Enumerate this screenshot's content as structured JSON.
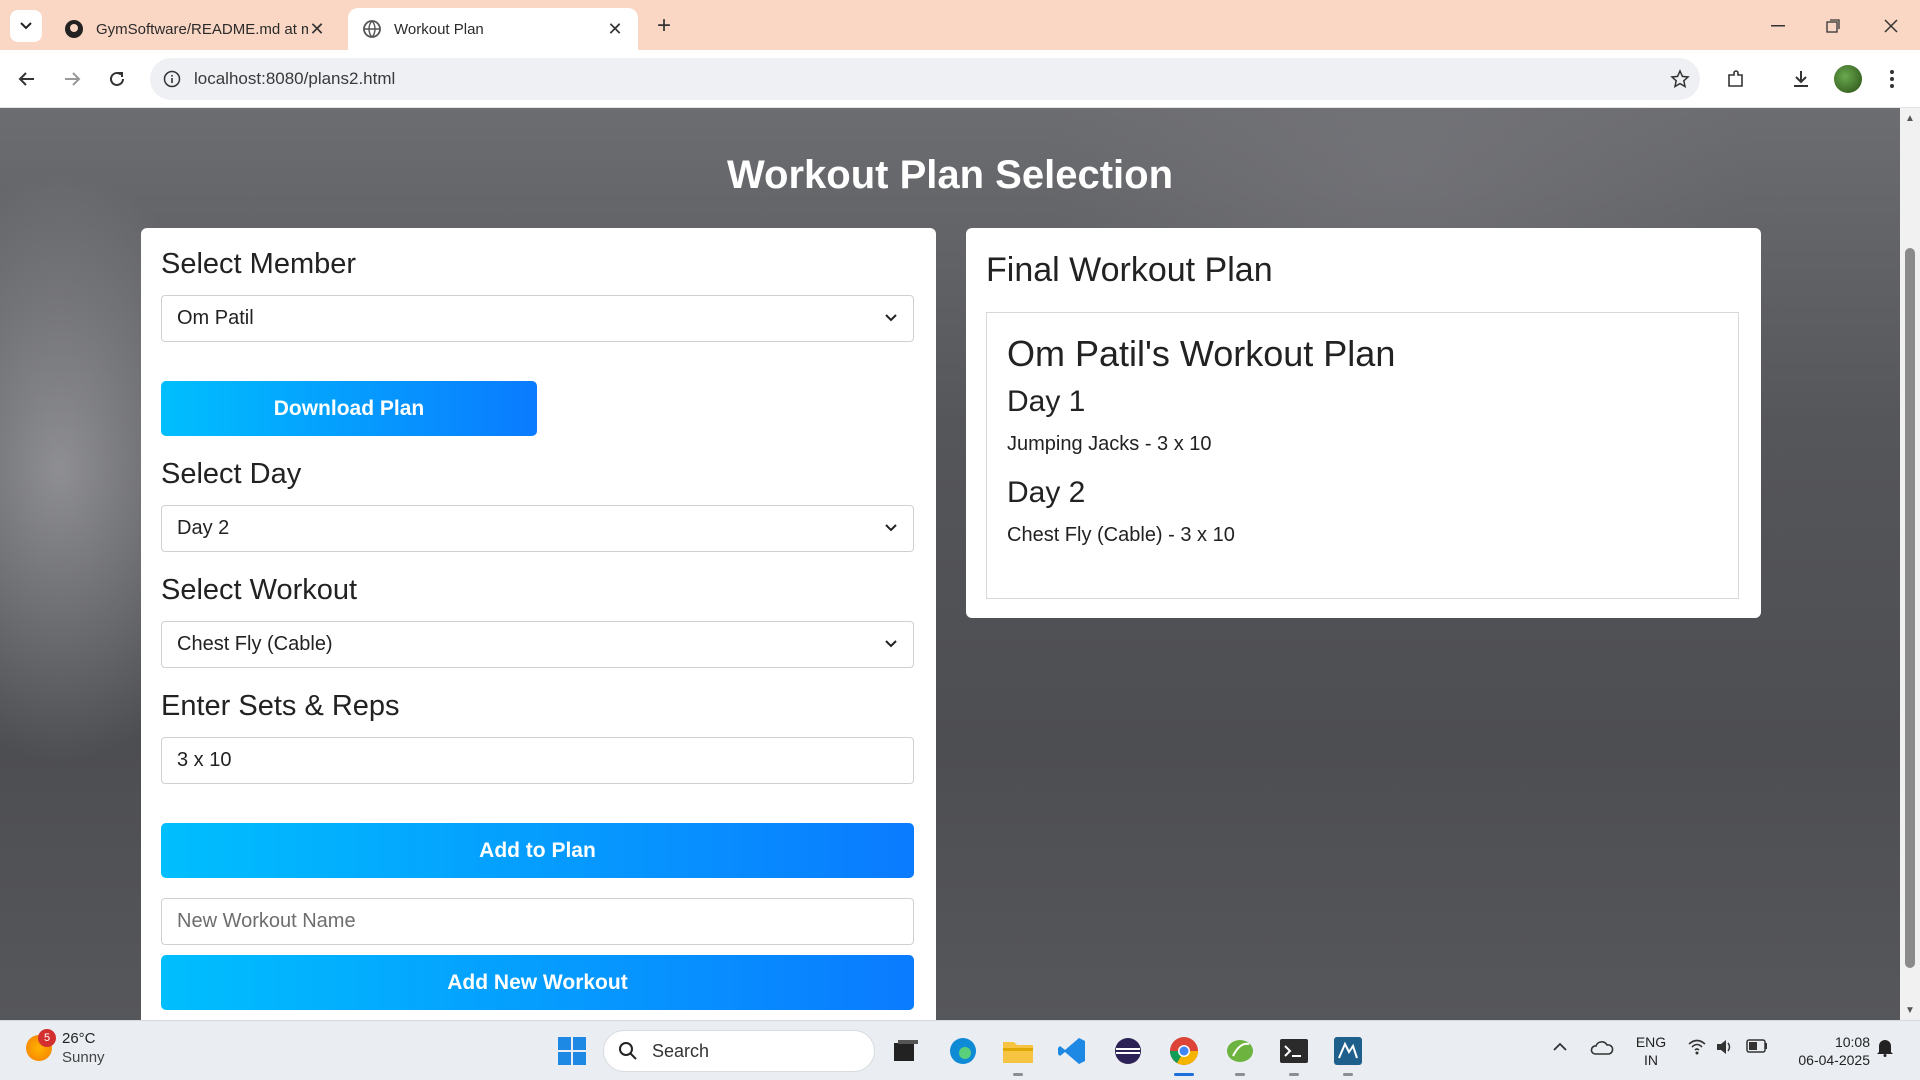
{
  "browser": {
    "tabs": [
      {
        "title": "GymSoftware/README.md at m",
        "icon": "github-icon",
        "active": false
      },
      {
        "title": "Workout Plan",
        "icon": "globe-icon",
        "active": true
      }
    ],
    "url": "localhost:8080/plans2.html"
  },
  "page": {
    "title": "Workout Plan Selection",
    "left": {
      "member_label": "Select Member",
      "member_value": "Om Patil",
      "download_button": "Download Plan",
      "day_label": "Select Day",
      "day_value": "Day 2",
      "workout_label": "Select Workout",
      "workout_value": "Chest Fly (Cable)",
      "sets_label": "Enter Sets & Reps",
      "sets_value": "3 x 10",
      "add_button": "Add to Plan",
      "new_workout_placeholder": "New Workout Name",
      "add_new_button": "Add New Workout"
    },
    "right": {
      "title": "Final Workout Plan",
      "plan_title": "Om Patil's Workout Plan",
      "days": [
        {
          "label": "Day 1",
          "item": "Jumping Jacks - 3 x 10"
        },
        {
          "label": "Day 2",
          "item": "Chest Fly (Cable) - 3 x 10"
        }
      ]
    }
  },
  "taskbar": {
    "weather_badge": "5",
    "temp": "26°C",
    "condition": "Sunny",
    "search": "Search",
    "lang_top": "ENG",
    "lang_bottom": "IN",
    "time": "10:08",
    "date": "06-04-2025"
  },
  "colors": {
    "accent_start": "#00bffe",
    "accent_end": "#0a7bff",
    "tabstrip": "#fad7c4"
  }
}
